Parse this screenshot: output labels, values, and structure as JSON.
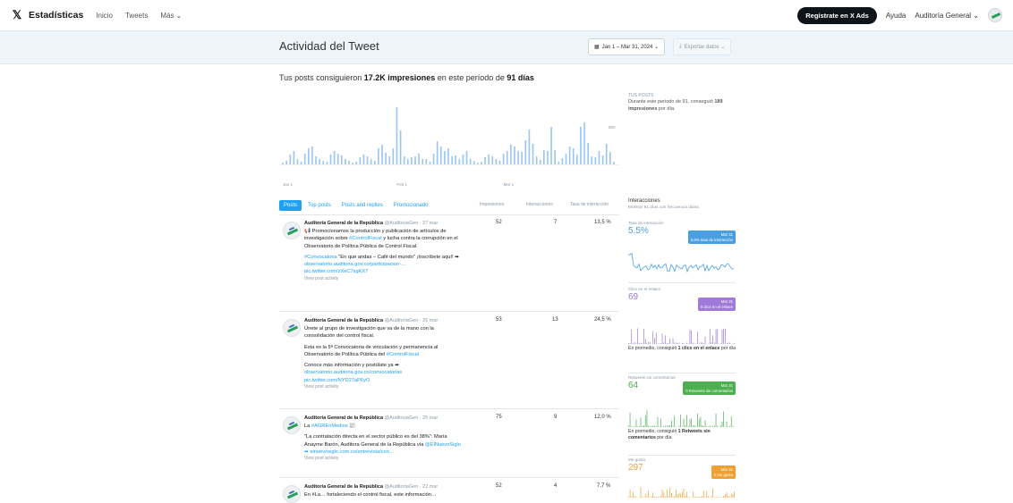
{
  "nav": {
    "brand": "Estadísticas",
    "links": [
      "Inicio",
      "Tweets",
      "Más ⌄"
    ],
    "ads_button": "Regístrate en X Ads",
    "help": "Ayuda",
    "account": "Auditoría General ⌄"
  },
  "header": {
    "title": "Actividad del Tweet",
    "date_range": "Jan 1 – Mar 31, 2024 ⌄",
    "export": "Exportar datos ⌄"
  },
  "summary": {
    "prefix": "Tus posts consiguieron ",
    "impressions": "17.2K impresiones",
    "middle": " en este período de ",
    "days": "91 días"
  },
  "main_chart": {
    "y_tick": "500",
    "x_ticks": [
      "Jan 1",
      "Feb 1",
      "Mar 1"
    ],
    "bar_color": "#9ac6f0"
  },
  "chart_data": {
    "type": "bar",
    "title": "",
    "xlabel": "",
    "ylabel": "",
    "ylim": [
      0,
      800
    ],
    "categories_start": "Jan 1",
    "values": [
      20,
      40,
      110,
      150,
      60,
      30,
      120,
      180,
      200,
      90,
      60,
      40,
      30,
      110,
      150,
      120,
      100,
      60,
      40,
      20,
      30,
      80,
      110,
      90,
      60,
      40,
      180,
      220,
      130,
      90,
      180,
      640,
      380,
      90,
      60,
      80,
      90,
      120,
      60,
      60,
      30,
      120,
      260,
      200,
      150,
      180,
      90,
      100,
      60,
      110,
      150,
      60,
      40,
      20,
      30,
      80,
      110,
      90,
      60,
      40,
      120,
      150,
      220,
      200,
      150,
      140,
      270,
      390,
      230,
      90,
      50,
      160,
      150,
      420,
      160,
      30,
      70,
      120,
      200,
      180,
      110,
      420,
      470,
      240,
      90,
      80,
      150,
      100,
      230,
      140,
      30
    ]
  },
  "side_summary": {
    "label": "TUS POSTS",
    "text": "Durante este periodo de 91, conseguió ",
    "value": "189 impresiones",
    "suffix": " por día."
  },
  "tabs": {
    "items": [
      "Posts",
      "Top posts",
      "Posts and replies",
      "Promocionado"
    ],
    "col_impressions": "Impresiones",
    "col_interactions": "Interacciones",
    "col_rate": "Tasa de interacción"
  },
  "tweets": [
    {
      "name": "Auditoría General de la República",
      "handle": "@AuditoriaGen · 27 mar",
      "lines": [
        "📢 Promocionamos la producción y publicación de artículos de investigación sobre ",
        "#ControlFiscal",
        " y lucha contra la corrupción en el Observatorio de Política Pública de Control Fiscal."
      ],
      "p2_tag": "#Convocatoria",
      "p2_text": " \"En qué andas – Café del mundo\" ¡Inscríbete aquí! ➡",
      "link1": "observatorio.auditoria.gov.co/participacion-…",
      "link2": "pic.twitter.com/zXeC7sgKX7",
      "activity": "View post activity",
      "impressions": "52",
      "interactions": "7",
      "rate": "13,5 %"
    },
    {
      "name": "Auditoría General de la República",
      "handle": "@AuditoriaGen · 26 mar",
      "lines": [
        "Únete al grupo de investigación que va de la mano con la consolidación del control fiscal."
      ],
      "p2_text": "Esta es la 5ª Convocatoria de vinculación y permanencia al Observatorio de Política Pública del ",
      "p2_tag": "#ControlFiscal",
      "p3_text": "Conoce más información y postúlate ya ➡",
      "link1": "observatorio.auditoria.gov.co/convocatorias",
      "link2": "pic.twitter.com/NYD27aP6yO",
      "activity": "View post activity",
      "impressions": "53",
      "interactions": "13",
      "rate": "24,5 %"
    },
    {
      "name": "Auditoría General de la República",
      "handle": "@AuditoriaGen · 25 mar",
      "lines": [
        "La ",
        "#AGREnMedios",
        " 📰"
      ],
      "p2_text": "\"La contratación directa en el sector público es del 38%\": María Anayme Barón, Auditora General de la República vía ",
      "p2_tag": "@ElNuevoSiglo",
      "p2_after": " ➡ elnuevosiglo.com.co/entrevista/con…",
      "activity": "View post activity",
      "impressions": "75",
      "interactions": "9",
      "rate": "12,0 %"
    },
    {
      "name": "Auditoría General de la República",
      "handle": "@AuditoriaGen · 22 mar",
      "lines": [
        "En #La… fortaleciendo el control fiscal, este información…"
      ],
      "impressions": "52",
      "interactions": "4",
      "rate": "7,7 %"
    }
  ],
  "interactions_panel": {
    "title": "Interacciones",
    "subtitle": "Mostrar 91 días con frecuencia diaria",
    "cards": [
      {
        "label": "Tasa de interacción",
        "value": "5.5%",
        "color": "#4a9fe0",
        "tip_date": "Mar 31",
        "tip_text": "6.0% tasa de interacción",
        "footer": ""
      },
      {
        "label": "Clics en el enlace",
        "value": "69",
        "color": "#9f7ad9",
        "tip_date": "Mar 31",
        "tip_text": "0 clics en el enlace",
        "footer_pre": "En promedio, consiguió ",
        "footer_bold": "1 clics en el enlace",
        "footer_post": " por día"
      },
      {
        "label": "Retweets sin comentarios",
        "value": "64",
        "color": "#4caf50",
        "tip_date": "Mar 31",
        "tip_text": "0 Retweets sin comentarios",
        "footer_pre": "En promedio, consiguió ",
        "footer_bold": "1 Retweets sin comentarios",
        "footer_post": " por día"
      },
      {
        "label": "Me gusta",
        "value": "297",
        "color": "#f0a030",
        "tip_date": "Mar 31",
        "tip_text": "0 me gusta",
        "footer": ""
      }
    ]
  }
}
